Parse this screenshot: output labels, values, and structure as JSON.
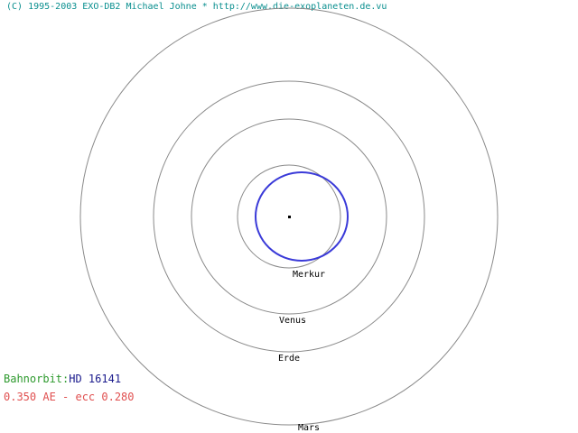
{
  "copyright": "(C) 1995-2003 EXO-DB2 Michael Johne * http://www.die-exoplaneten.de.vu",
  "planet_orbits": [
    {
      "name": "Merkur"
    },
    {
      "name": "Venus"
    },
    {
      "name": "Erde"
    },
    {
      "name": "Mars"
    }
  ],
  "info": {
    "label": "Bahnorbit:",
    "star": "HD 16141",
    "params": "0.350 AE - ecc 0.280"
  },
  "colors": {
    "copyright": "#0a8f8f",
    "reference_orbit": "#8a8a8a",
    "exoplanet_orbit": "#3a3ad8",
    "label": "#2e9a2e",
    "star_name": "#1a1a8c",
    "params": "#e05050"
  }
}
